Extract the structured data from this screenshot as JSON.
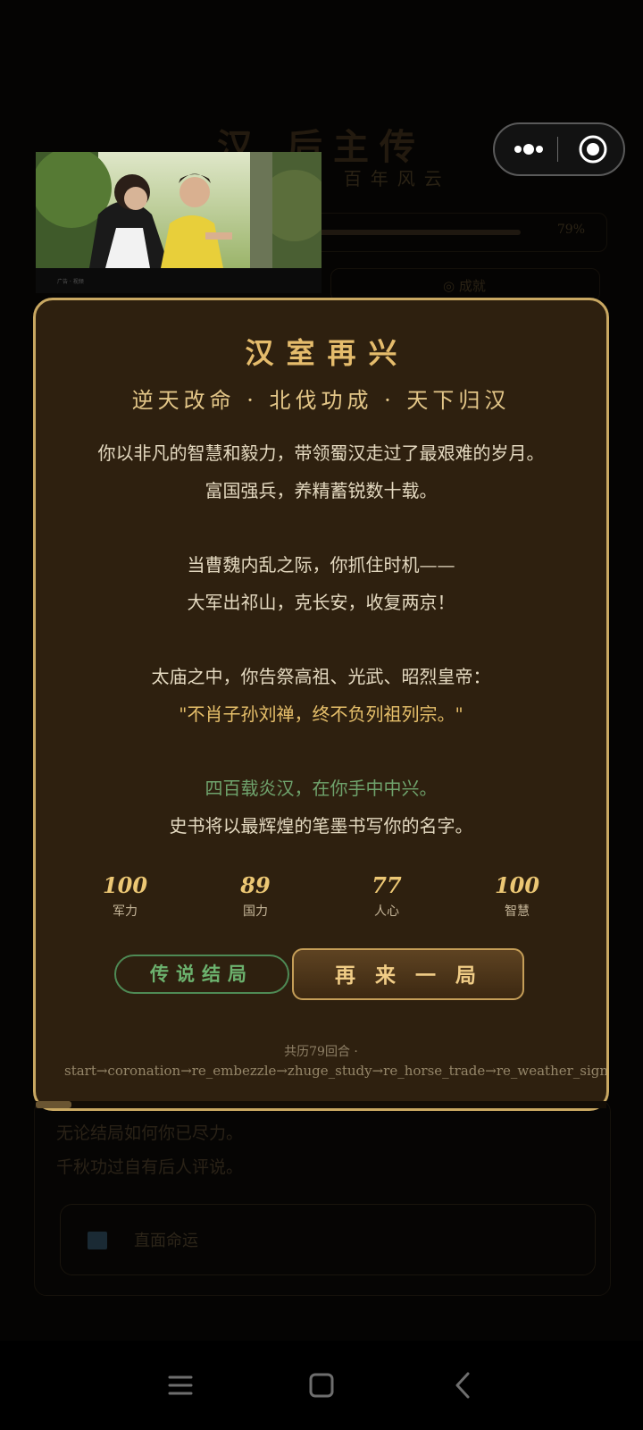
{
  "background_page": {
    "title": "汉 后主传",
    "subtitle": "· 百年风云",
    "progress_percent": "79%",
    "progress_fraction": 0.79,
    "pill_label": "◎ 成就",
    "card_line1": "无论结局如何你已尽力。",
    "card_line2": "千秋功过自有后人评说。",
    "card_button_label": "直面命运"
  },
  "capsule": {
    "more_icon": "more-dots-icon",
    "close_icon": "target-close-icon"
  },
  "video": {
    "caption": "广告 · 视频"
  },
  "modal": {
    "title": "汉室再兴",
    "subtitle": "逆天改命 · 北伐功成 · 天下归汉",
    "story": {
      "p1": "你以非凡的智慧和毅力，带领蜀汉走过了最艰难的岁月。",
      "p2": "富国强兵，养精蓄锐数十载。",
      "p3": "当曹魏内乱之际，你抓住时机——",
      "p4": "大军出祁山，克长安，收复两京！",
      "p5": "太庙之中，你告祭高祖、光武、昭烈皇帝：",
      "p6": "\"不肖子孙刘禅，终不负列祖列宗。\"",
      "p7": "四百载炎汉，在你手中中兴。",
      "p8": "史书将以最辉煌的笔墨书写你的名字。"
    },
    "stats": [
      {
        "value": "100",
        "label": "军力"
      },
      {
        "value": "89",
        "label": "国力"
      },
      {
        "value": "77",
        "label": "人心"
      },
      {
        "value": "100",
        "label": "智慧"
      }
    ],
    "legend_button": "传说结局",
    "again_button": "再来一局",
    "footer_round": "共历79回合 ·",
    "footer_path": "start→coronation→re_embezzle→zhuge_study→re_horse_trade→re_weather_sign"
  },
  "navbar": {
    "menu_icon": "menu-icon",
    "home_icon": "home-icon",
    "back_icon": "back-icon"
  },
  "colors": {
    "accent_gold": "#c9a862",
    "modal_bg": "#2e200f",
    "legend_green": "#4e8a55"
  }
}
